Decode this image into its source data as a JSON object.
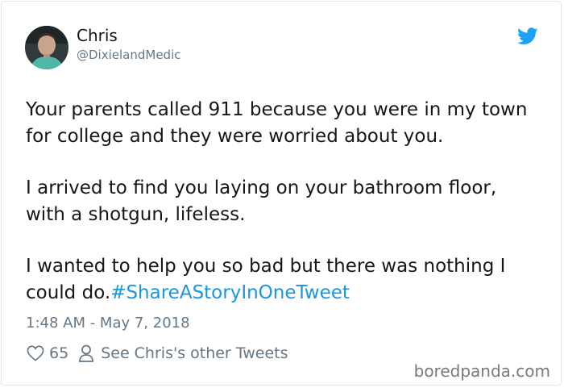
{
  "author": {
    "name": "Chris",
    "handle": "@DixielandMedic",
    "avatar_icon": "profile-photo"
  },
  "tweet": {
    "paragraphs": [
      "Your parents called 911 because you were in my town for college and they were worried about you.",
      "I arrived to find you laying on your bathroom floor, with a shotgun, lifeless.",
      "I wanted to help you so bad but there was nothing I could do."
    ],
    "hashtag": "#ShareAStoryInOneTweet",
    "timestamp": "1:48 AM - May 7, 2018"
  },
  "actions": {
    "like_count": "65",
    "other_tweets_label": "See Chris's other Tweets"
  },
  "watermark": "boredpanda.com",
  "colors": {
    "text": "#14171a",
    "secondary": "#657786",
    "link": "#1b95e0",
    "twitter_blue": "#1da1f2",
    "border": "#e1e8ed"
  },
  "icons": [
    "twitter-bird-icon",
    "heart-icon",
    "person-icon"
  ]
}
